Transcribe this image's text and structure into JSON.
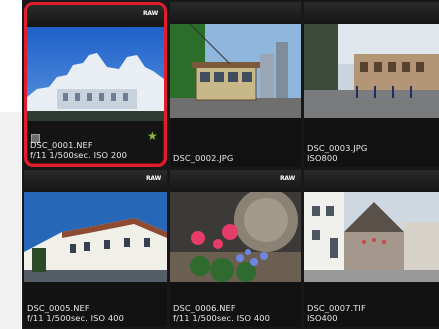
{
  "thumbnails": [
    {
      "id": "t1",
      "filename": "DSC_0001.NEF",
      "info": "f/11 1/500sec. ISO 200",
      "badge": "RAW",
      "selected": true,
      "rated": true
    },
    {
      "id": "t2",
      "filename": "DSC_0002.JPG",
      "info": "",
      "badge": "",
      "selected": false,
      "rated": false
    },
    {
      "id": "t3",
      "filename": "DSC_0003.JPG",
      "info": "ISO800",
      "badge": "",
      "selected": false,
      "rated": false
    },
    {
      "id": "t4",
      "filename": "DSC_0005.NEF",
      "info": "f/11 1/500sec. ISO 400",
      "badge": "RAW",
      "selected": false,
      "rated": false
    },
    {
      "id": "t5",
      "filename": "DSC_0006.NEF",
      "info": "f/11 1/500sec. ISO 400",
      "badge": "RAW",
      "selected": false,
      "rated": false
    },
    {
      "id": "t6",
      "filename": "DSC_0007.TIF",
      "info": "ISO400",
      "badge": "",
      "selected": false,
      "rated": false
    }
  ],
  "colors": {
    "selection": "#e11e2b",
    "rating_star": "#8bb53b"
  }
}
